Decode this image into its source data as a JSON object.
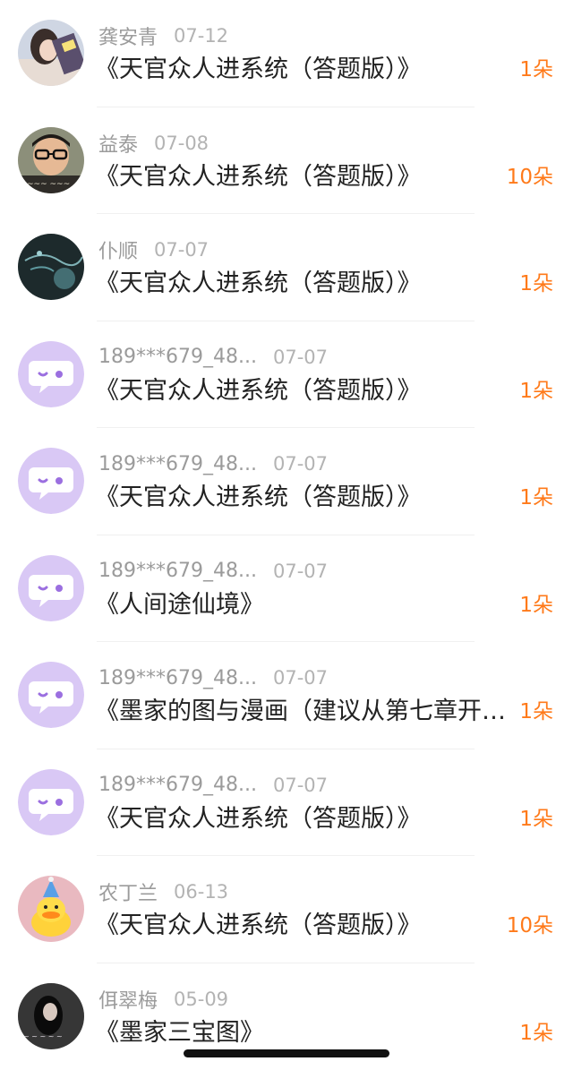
{
  "records": [
    {
      "name": "龚安青",
      "date": "07-12",
      "title": "《天官众人进系统（答题版）》",
      "gift": "1朵",
      "avatar": "photo-woman"
    },
    {
      "name": "益泰",
      "date": "07-08",
      "title": "《天官众人进系统（答题版）》",
      "gift": "10朵",
      "avatar": "photo-glasses"
    },
    {
      "name": "仆顺",
      "date": "07-07",
      "title": "《天官众人进系统（答题版）》",
      "gift": "1朵",
      "avatar": "photo-dark-art"
    },
    {
      "name": "189***679_48...",
      "date": "07-07",
      "title": "《天官众人进系统（答题版）》",
      "gift": "1朵",
      "avatar": "default-chat-icon"
    },
    {
      "name": "189***679_48...",
      "date": "07-07",
      "title": "《天官众人进系统（答题版）》",
      "gift": "1朵",
      "avatar": "default-chat-icon"
    },
    {
      "name": "189***679_48...",
      "date": "07-07",
      "title": "《人间途仙境》",
      "gift": "1朵",
      "avatar": "default-chat-icon"
    },
    {
      "name": "189***679_48...",
      "date": "07-07",
      "title": "《墨家的图与漫画（建议从第七章开始看）》",
      "gift": "1朵",
      "avatar": "default-chat-icon"
    },
    {
      "name": "189***679_48...",
      "date": "07-07",
      "title": "《天官众人进系统（答题版）》",
      "gift": "1朵",
      "avatar": "default-chat-icon"
    },
    {
      "name": "农丁兰",
      "date": "06-13",
      "title": "《天官众人进系统（答题版）》",
      "gift": "10朵",
      "avatar": "photo-duck"
    },
    {
      "name": "佴翠梅",
      "date": "05-09",
      "title": "《墨家三宝图》",
      "gift": "1朵",
      "avatar": "photo-dark"
    }
  ],
  "colors": {
    "gift": "#ff7a1a",
    "default_avatar_bg": "#d9c8f5",
    "default_avatar_icon": "#ffffff",
    "default_avatar_eye": "#9b6fe0"
  }
}
